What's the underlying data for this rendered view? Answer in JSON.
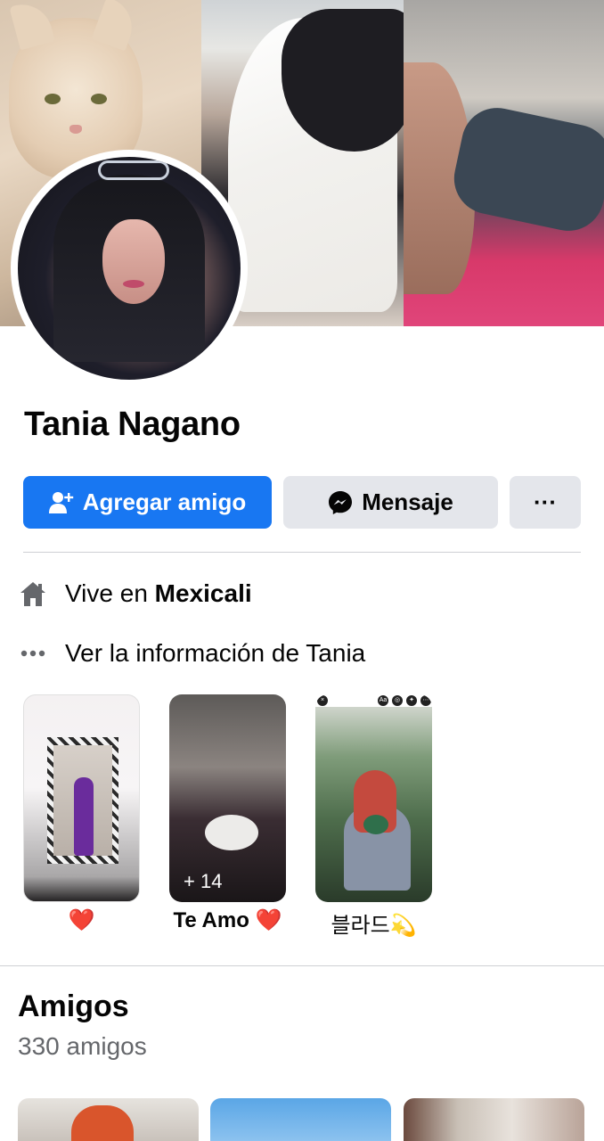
{
  "profile": {
    "name": "Tania Nagano"
  },
  "actions": {
    "add_friend_label": "Agregar amigo",
    "message_label": "Mensaje",
    "more_label": "···"
  },
  "intro": {
    "lives_prefix": "Vive en ",
    "lives_city": "Mexicali",
    "see_info": "Ver la información de Tania"
  },
  "featured": [
    {
      "label": "❤️",
      "extra": ""
    },
    {
      "label": "Te Amo ❤️",
      "extra": "+ 14"
    },
    {
      "label": "블라드💫",
      "extra": ""
    }
  ],
  "friends": {
    "title": "Amigos",
    "count": "330 amigos"
  },
  "colors": {
    "primary": "#1877f2",
    "secondary_button": "#e4e6eb",
    "muted_text": "#65676b"
  }
}
